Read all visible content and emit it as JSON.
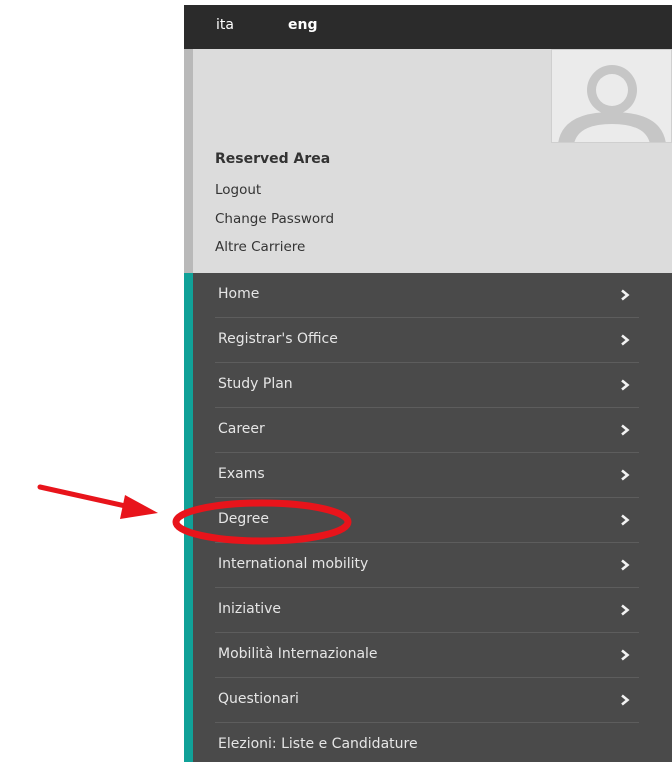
{
  "lang": {
    "ita": "ita",
    "eng": "eng"
  },
  "user_area": {
    "title": "Reserved Area",
    "links": [
      "Logout",
      "Change Password",
      "Altre Carriere"
    ]
  },
  "menu": {
    "items": [
      {
        "label": "Home",
        "icon": "chevron-right-icon"
      },
      {
        "label": "Registrar's Office",
        "icon": "chevron-right-icon"
      },
      {
        "label": "Study Plan",
        "icon": "chevron-right-icon"
      },
      {
        "label": "Career",
        "icon": "chevron-right-icon"
      },
      {
        "label": "Exams",
        "icon": "chevron-right-icon"
      },
      {
        "label": "Degree",
        "icon": "chevron-right-icon"
      },
      {
        "label": "International mobility",
        "icon": "chevron-right-icon"
      },
      {
        "label": "Iniziative",
        "icon": "chevron-right-icon"
      },
      {
        "label": "Mobilità Internazionale",
        "icon": "chevron-right-icon"
      },
      {
        "label": "Questionari",
        "icon": "chevron-right-icon"
      },
      {
        "label": "Elezioni: Liste e Candidature"
      }
    ]
  },
  "colors": {
    "lang_bar": "#2b2b2b",
    "user_area": "#dcdcdc",
    "menu_bg": "#4a4a4a",
    "accent": "#10a198",
    "annotation": "#e8141b"
  },
  "annotation": {
    "arrow_icon": "red-arrow-icon",
    "highlight": "red-ellipse-highlight"
  }
}
